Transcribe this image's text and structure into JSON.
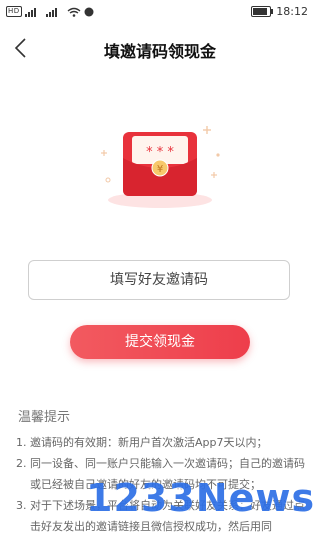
{
  "status_bar": {
    "left_indicators": "HD 4G 4G",
    "time": "18:12",
    "battery_level": 0.85
  },
  "header": {
    "title": "填邀请码领现金"
  },
  "form": {
    "input_placeholder": "填写好友邀请码",
    "submit_label": "提交领现金"
  },
  "tips": {
    "title": "温馨提示",
    "items": [
      {
        "num": "1.",
        "text": "邀请码的有效期：新用户首次激活App7天以内；"
      },
      {
        "num": "2.",
        "text": "同一设备、同一账户只能输入一次邀请码；自己的邀请码或已经被自己邀请的好友的邀请码均不可提交；"
      },
      {
        "num": "3.",
        "text": "对于下述场景，平台将自动为关联好友关系：好友通过点击好友发出的邀请链接且微信授权成功，然后用同"
      }
    ]
  },
  "hero": {
    "envelope_stars": "* * *",
    "coin_symbol": "¥"
  },
  "watermark": "1233News",
  "colors": {
    "accent": "#ee3e4b",
    "envelope": "#e8323c",
    "watermark": "#2d6fe6"
  }
}
